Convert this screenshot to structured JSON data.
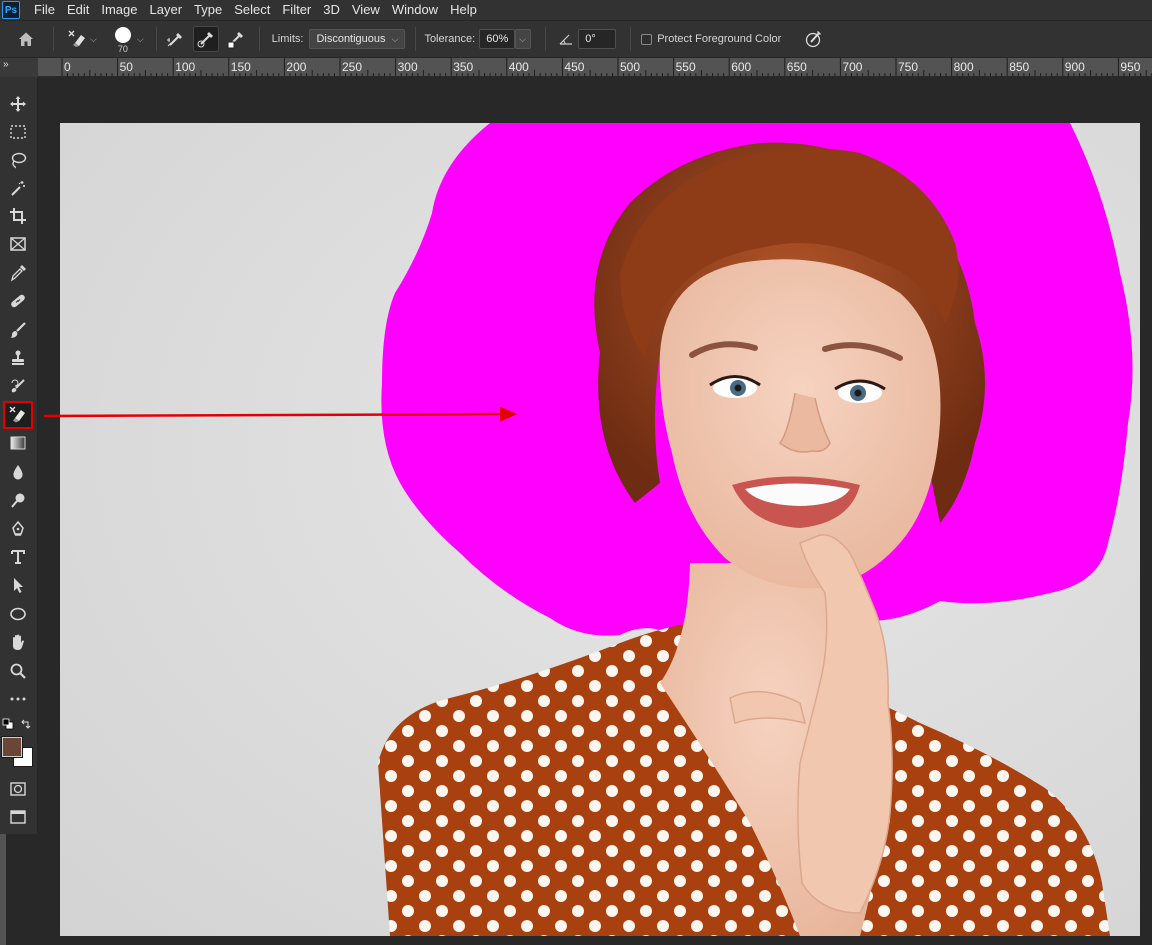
{
  "menu": {
    "logo": "Ps",
    "items": [
      "File",
      "Edit",
      "Image",
      "Layer",
      "Type",
      "Select",
      "Filter",
      "3D",
      "View",
      "Window",
      "Help"
    ]
  },
  "options": {
    "brush_size": "70",
    "limits_label": "Limits:",
    "limits_value": "Discontiguous",
    "tolerance_label": "Tolerance:",
    "tolerance_value": "60%",
    "angle_value": "0°",
    "protect_label": "Protect Foreground Color"
  },
  "ruler": {
    "corner": "»",
    "ticks": [
      "0",
      "50",
      "100",
      "150",
      "200",
      "250",
      "300",
      "350",
      "400",
      "450",
      "500",
      "550",
      "600",
      "650",
      "700",
      "750",
      "800",
      "850",
      "900",
      "950"
    ]
  },
  "toolbar": {
    "tools": [
      "move-tool",
      "marquee-tool",
      "lasso-tool",
      "magic-wand-tool",
      "crop-tool",
      "frame-tool",
      "eyedropper-tool",
      "healing-brush-tool",
      "brush-tool",
      "clone-stamp-tool",
      "history-brush-tool",
      "background-eraser-tool",
      "gradient-tool",
      "blur-tool",
      "dodge-tool",
      "pen-tool",
      "type-tool",
      "path-selection-tool",
      "ellipse-tool",
      "hand-tool",
      "zoom-tool",
      "edit-toolbar"
    ],
    "selected_tool": "background-eraser-tool",
    "foreground_color": "#6b4636",
    "background_color": "#ffffff"
  },
  "colors": {
    "highlight_magenta": "#ff00ff",
    "annotation_red": "#e30000",
    "backdrop_gray": "#dcdcdc"
  }
}
